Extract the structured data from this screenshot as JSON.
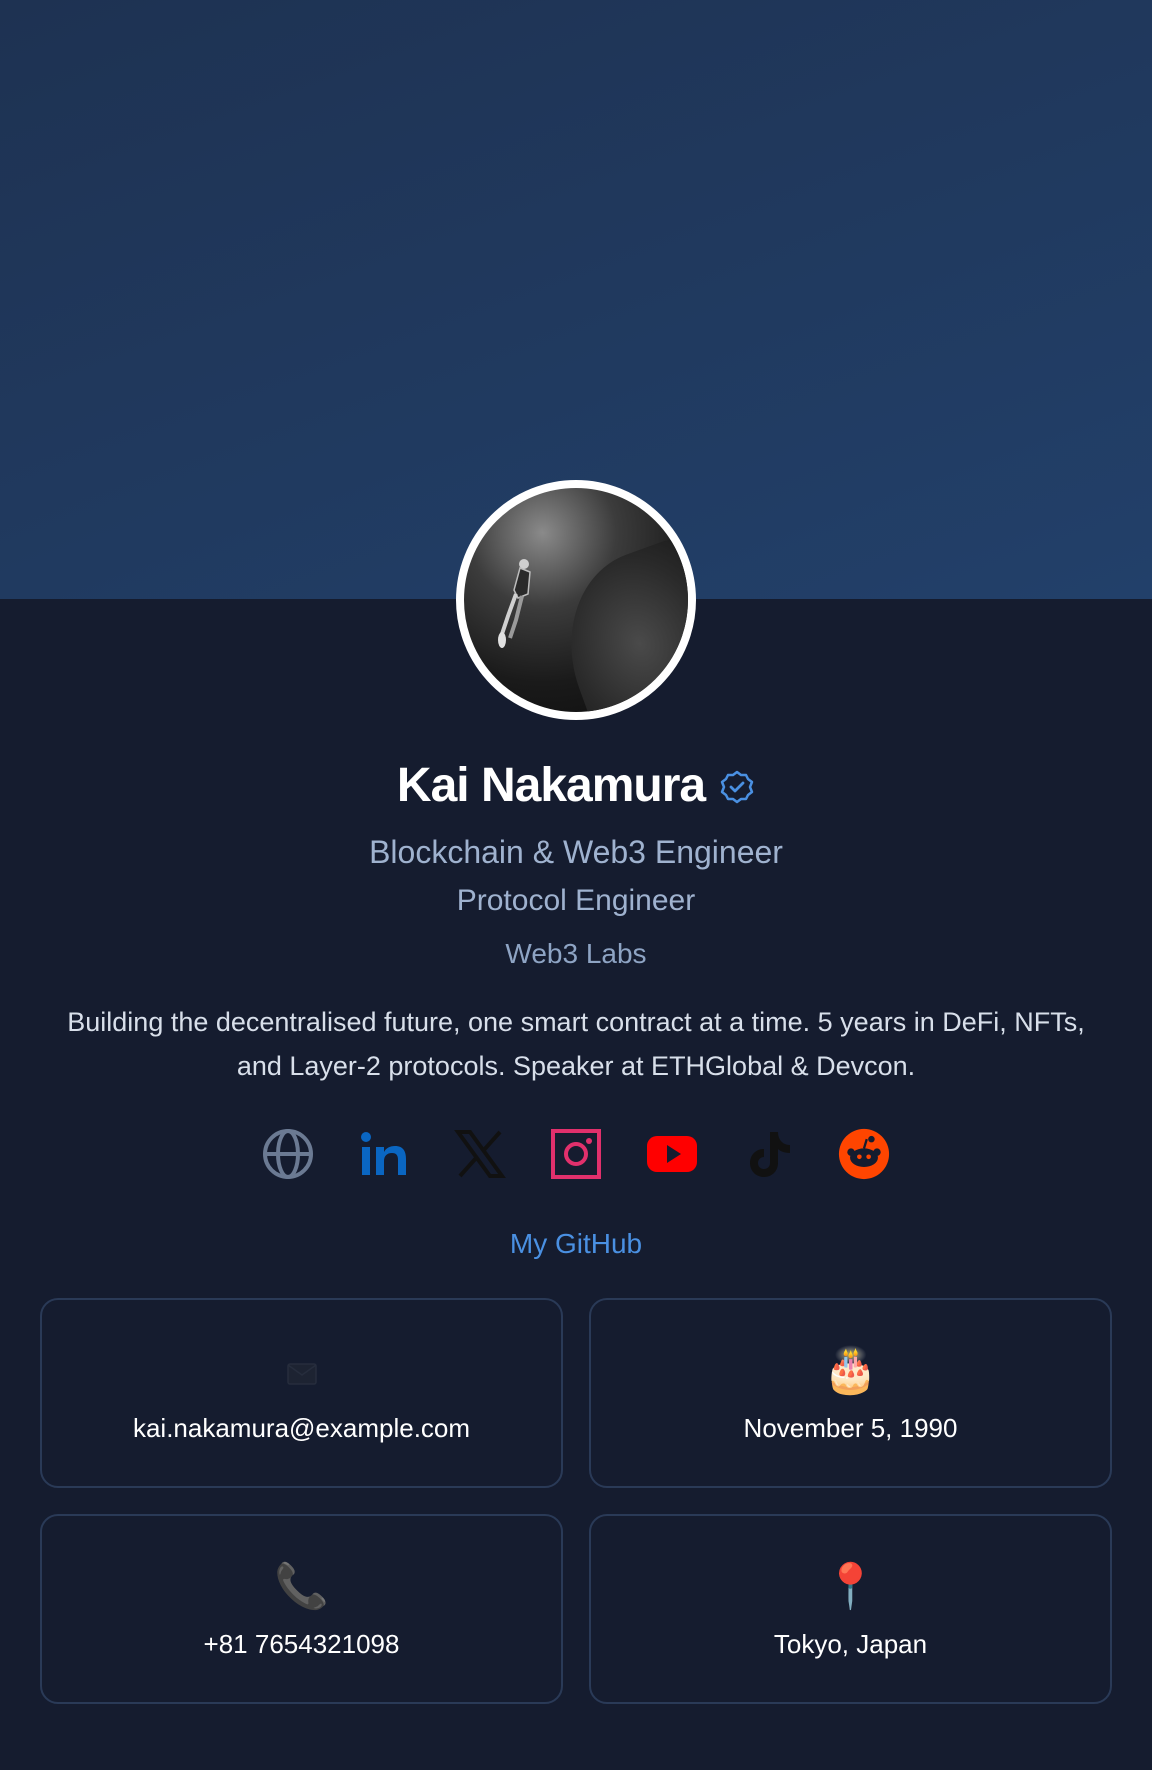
{
  "profile": {
    "name": "Kai Nakamura",
    "title": "Blockchain & Web3 Engineer",
    "role": "Protocol Engineer",
    "company": "Web3 Labs",
    "bio": "Building the decentralised future, one smart contract at a time. 5 years in DeFi, NFTs, and Layer-2 protocols. Speaker at ETHGlobal & Devcon.",
    "verified": true
  },
  "socials": [
    {
      "icon": "globe-icon",
      "color": "#6b7a93"
    },
    {
      "icon": "linkedin-icon",
      "color": "#0a66c2"
    },
    {
      "icon": "x-icon",
      "color": "#111111"
    },
    {
      "icon": "instagram-icon",
      "color": "#e1306c"
    },
    {
      "icon": "youtube-icon",
      "color": "#ff0000"
    },
    {
      "icon": "tiktok-icon",
      "color": "#111111"
    },
    {
      "icon": "reddit-icon",
      "color": "#ff4500"
    }
  ],
  "github_link": "My GitHub",
  "cards": {
    "email": {
      "icon": "envelope-icon",
      "value": "kai.nakamura@example.com"
    },
    "birthday": {
      "icon": "cake-icon",
      "glyph": "🎂",
      "value": "November 5, 1990"
    },
    "phone": {
      "icon": "phone-icon",
      "glyph": "📞",
      "value": "+81 7654321098"
    },
    "location": {
      "icon": "pin-icon",
      "glyph": "📍",
      "value": "Tokyo, Japan"
    }
  },
  "colors": {
    "background": "#151c2f",
    "cover": "#22406a",
    "accent": "#4a90e2",
    "muted_text": "#9fb2cf"
  }
}
